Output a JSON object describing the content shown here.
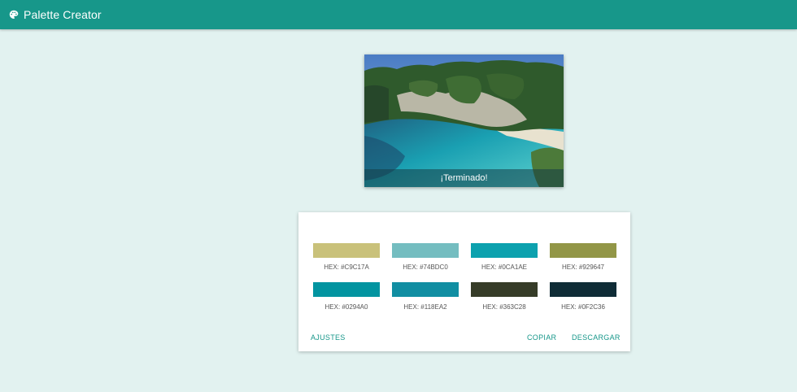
{
  "app": {
    "title": "Palette Creator",
    "icon": "palette-icon",
    "accent_color": "#17978a"
  },
  "image": {
    "status": "¡Terminado!"
  },
  "palette": {
    "swatches": [
      {
        "color": "#C9C17A",
        "label": "HEX: #C9C17A"
      },
      {
        "color": "#74BDC0",
        "label": "HEX: #74BDC0"
      },
      {
        "color": "#0CA1AE",
        "label": "HEX: #0CA1AE"
      },
      {
        "color": "#929647",
        "label": "HEX: #929647"
      },
      {
        "color": "#0294A0",
        "label": "HEX: #0294A0"
      },
      {
        "color": "#118EA2",
        "label": "HEX: #118EA2"
      },
      {
        "color": "#363C28",
        "label": "HEX: #363C28"
      },
      {
        "color": "#0F2C36",
        "label": "HEX: #0F2C36"
      }
    ]
  },
  "actions": {
    "settings_label": "AJUSTES",
    "copy_label": "COPIAR",
    "download_label": "DESCARGAR"
  }
}
